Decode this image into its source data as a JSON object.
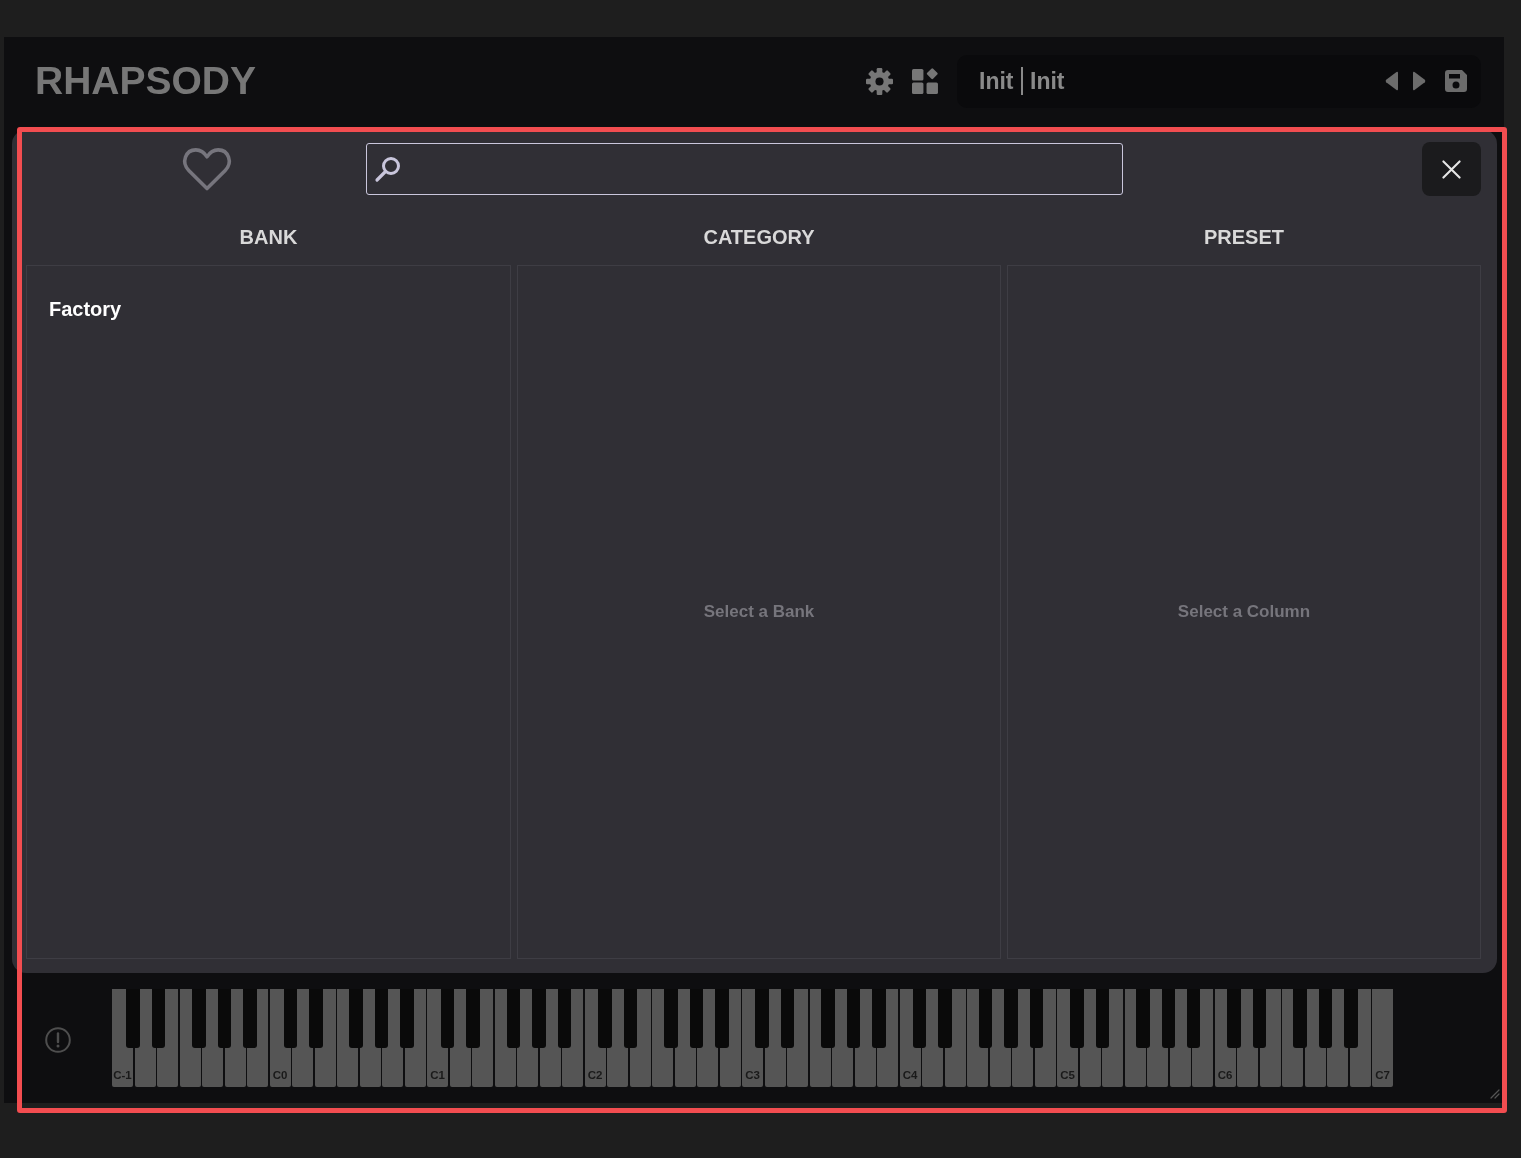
{
  "plugin": {
    "title": "RHAPSODY"
  },
  "preset_bar": {
    "bank": "Init",
    "preset": "Init"
  },
  "browser": {
    "columns": [
      {
        "title": "BANK",
        "items": [
          {
            "label": "Factory",
            "selected": false
          }
        ]
      },
      {
        "title": "CATEGORY",
        "empty_message": "Select a Bank"
      },
      {
        "title": "PRESET",
        "empty_message": "Select a Column"
      }
    ]
  },
  "keyboard": {
    "octave_labels": [
      "C-1",
      "C0",
      "C1",
      "C2",
      "C3",
      "C4",
      "C5",
      "C6",
      "C7"
    ]
  }
}
